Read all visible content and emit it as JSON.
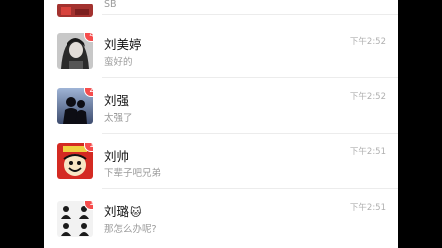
{
  "chats": [
    {
      "preview": "SB",
      "avatar": "red-image-avatar"
    },
    {
      "name": "刘美婷",
      "preview": "蛮好的",
      "time": "下午2:52",
      "unread": "4",
      "avatar": "girl-bw-avatar"
    },
    {
      "name": "刘强",
      "preview": "太强了",
      "time": "下午2:52",
      "unread": "2",
      "avatar": "silhouette-avatar"
    },
    {
      "name": "刘帅",
      "preview": "下辈子吧兄弟",
      "time": "下午2:51",
      "unread": "1",
      "avatar": "cartoon-red-avatar"
    },
    {
      "name": "刘璐",
      "name_emoji": "🐱",
      "preview": "那怎么办呢?",
      "time": "下午2:51",
      "unread": "1",
      "avatar": "grid-photos-avatar"
    }
  ],
  "colors": {
    "badge": "#f64c4c",
    "time": "#b0b0b0",
    "preview": "#9a9a9a"
  }
}
